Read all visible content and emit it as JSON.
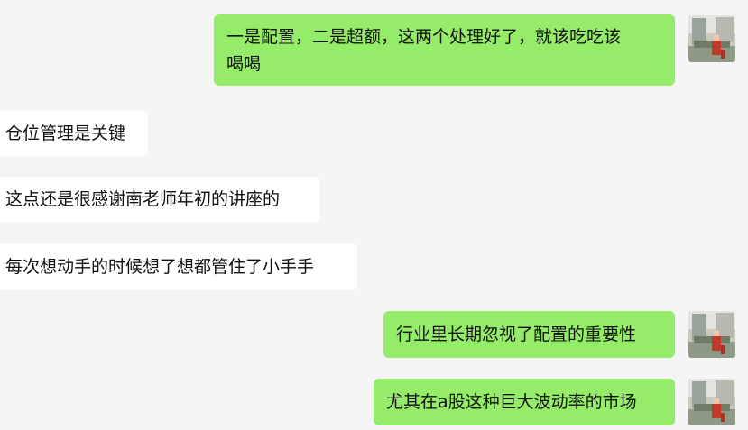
{
  "messages": [
    {
      "side": "out",
      "lines": [
        "一是配置，二是超额，这两个处理好了，就该吃吃该",
        "喝喝"
      ]
    },
    {
      "side": "in",
      "lines": [
        "仓位管理是关键"
      ]
    },
    {
      "side": "in",
      "lines": [
        "这点还是很感谢南老师年初的讲座的"
      ]
    },
    {
      "side": "in",
      "lines": [
        "每次想动手的时候想了想都管住了小手手"
      ]
    },
    {
      "side": "out",
      "lines": [
        "行业里长期忽视了配置的重要性"
      ]
    },
    {
      "side": "out",
      "lines": [
        "尤其在a股这种巨大波动率的市场"
      ]
    }
  ],
  "colors": {
    "background": "#f5f5f5",
    "outgoing_bubble": "#95ec69",
    "incoming_bubble": "#ffffff",
    "text": "#111111"
  },
  "avatar_icon": "user-avatar-photo"
}
